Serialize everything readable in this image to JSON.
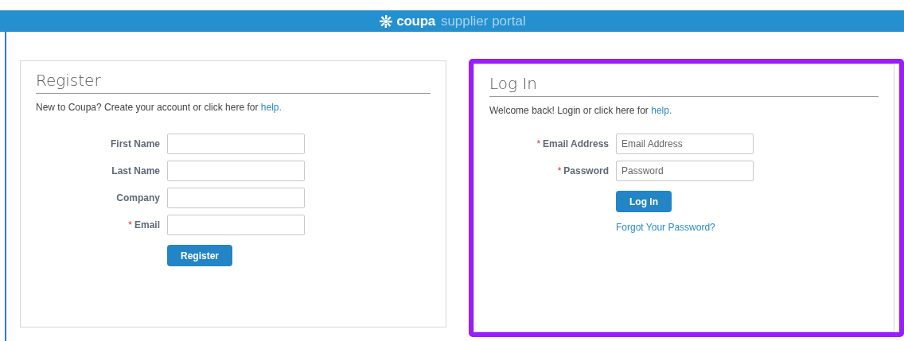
{
  "header": {
    "brand": "coupa",
    "product": "supplier portal"
  },
  "register": {
    "title": "Register",
    "intro": "New to Coupa? Create your account or click here for",
    "help_link": "help.",
    "highlighted": false,
    "fields": [
      {
        "label": "First Name"
      },
      {
        "label": "Last Name"
      },
      {
        "label": "Company"
      },
      {
        "label": "Email",
        "required_mark": "*"
      }
    ],
    "button": "Register"
  },
  "login": {
    "title": "Log In",
    "intro": "Welcome back! Login or click here for",
    "help_link": "help.",
    "highlighted": true,
    "fields": [
      {
        "label": "Email Address",
        "required_mark": "*",
        "placeholder": "Email Address"
      },
      {
        "label": "Password",
        "required_mark": "*",
        "placeholder": "Password"
      }
    ],
    "button": "Log In",
    "forgot_link": "Forgot Your Password?"
  }
}
